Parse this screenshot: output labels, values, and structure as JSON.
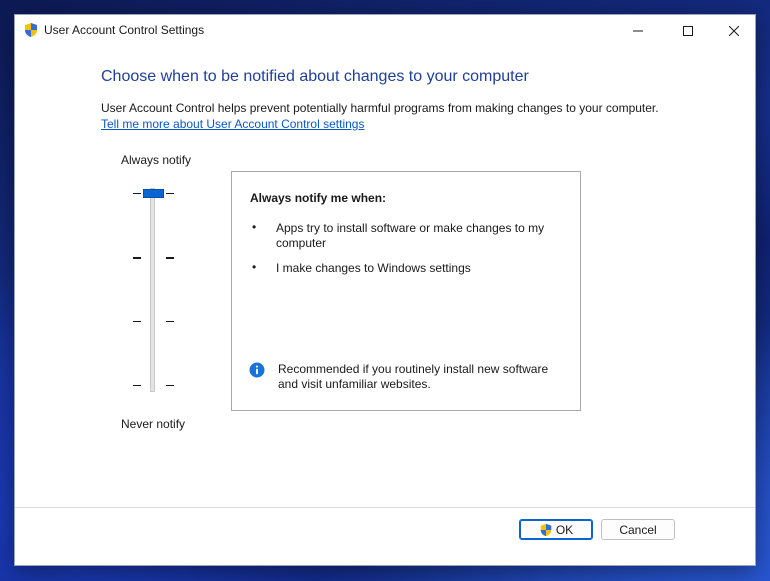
{
  "window": {
    "title": "User Account Control Settings",
    "title_icon": "uac-shield-icon"
  },
  "titlebar_controls": [
    "minimize-icon",
    "maximize-icon",
    "close-icon"
  ],
  "content": {
    "heading": "Choose when to be notified about changes to your computer",
    "description": "User Account Control helps prevent potentially harmful programs from making changes to your computer.",
    "link": "Tell me more about User Account Control settings"
  },
  "slider": {
    "top_label": "Always notify",
    "bottom_label": "Never notify",
    "levels": 4,
    "selected_level": 4
  },
  "info_panel": {
    "title": "Always notify me when:",
    "bullets": [
      "Apps try to install software or make changes to my computer",
      "I make changes to Windows settings"
    ],
    "note_icon": "info-icon",
    "note": "Recommended if you routinely install new software and visit unfamiliar websites."
  },
  "buttons": {
    "ok": "OK",
    "cancel": "Cancel"
  },
  "colors": {
    "heading": "#1f3f99",
    "link": "#0a58c8",
    "accent": "#0a64d2"
  }
}
